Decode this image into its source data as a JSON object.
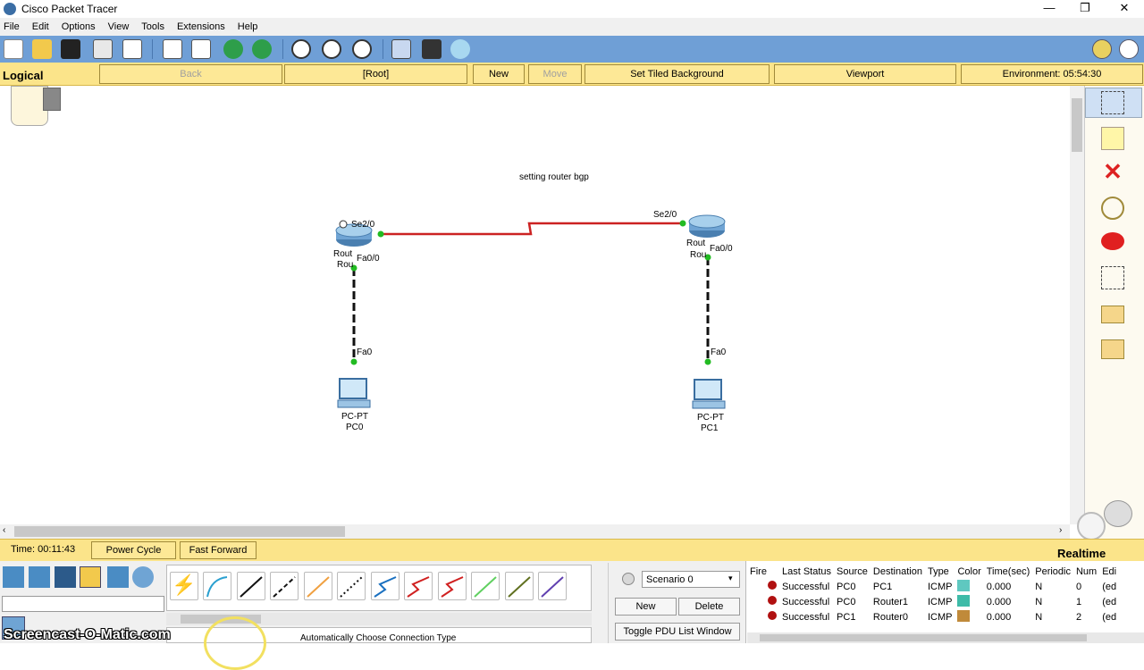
{
  "window": {
    "title": "Cisco Packet Tracer",
    "minimize": "—",
    "maximize": "❐",
    "close": "✕"
  },
  "menu": [
    "File",
    "Edit",
    "Options",
    "View",
    "Tools",
    "Extensions",
    "Help"
  ],
  "logical_bar": {
    "label": "Logical",
    "back": "Back",
    "root": "[Root]",
    "new_cluster": "New Cluster",
    "move_object": "Move Object",
    "tiled_bg": "Set Tiled Background",
    "viewport": "Viewport",
    "environment": "Environment: 05:54:30"
  },
  "canvas": {
    "note": "setting router bgp",
    "router0": {
      "port_serial": "Se2/0",
      "port_fa": "Fa0/0",
      "label1": "Rout",
      "label2": "Rou"
    },
    "router1": {
      "port_serial": "Se2/0",
      "port_fa": "Fa0/0",
      "label1": "Rout",
      "label2": "Rou"
    },
    "pc0": {
      "port": "Fa0",
      "model": "PC-PT",
      "name": "PC0"
    },
    "pc1": {
      "port": "Fa0",
      "model": "PC-PT",
      "name": "PC1"
    }
  },
  "status": {
    "time": "Time: 00:11:43",
    "power_cycle": "Power Cycle Devices",
    "fast_forward": "Fast Forward Time",
    "realtime": "Realtime"
  },
  "connection_type": "Automatically Choose Connection Type",
  "scenario": {
    "selected": "Scenario 0",
    "new": "New",
    "delete": "Delete",
    "toggle": "Toggle PDU List Window"
  },
  "pdu_table": {
    "headers": [
      "Fire",
      "Last Status",
      "Source",
      "Destination",
      "Type",
      "Color",
      "Time(sec)",
      "Periodic",
      "Num",
      "Edi"
    ],
    "rows": [
      {
        "status": "Successful",
        "source": "PC0",
        "destination": "PC1",
        "type": "ICMP",
        "color": "#5fc8c0",
        "time": "0.000",
        "periodic": "N",
        "num": "0",
        "edit": "(ed"
      },
      {
        "status": "Successful",
        "source": "PC0",
        "destination": "Router1",
        "type": "ICMP",
        "color": "#3dbba8",
        "time": "0.000",
        "periodic": "N",
        "num": "1",
        "edit": "(ed"
      },
      {
        "status": "Successful",
        "source": "PC1",
        "destination": "Router0",
        "type": "ICMP",
        "color": "#c08a3a",
        "time": "0.000",
        "periodic": "N",
        "num": "2",
        "edit": "(ed"
      }
    ]
  },
  "watermark": "Screencast-O-Matic.com",
  "colors": {
    "toolbar": "#6f9fd6",
    "logical_bar": "#fbe48a",
    "serial_link": "#cc2222",
    "port_up": "#22bb22"
  }
}
